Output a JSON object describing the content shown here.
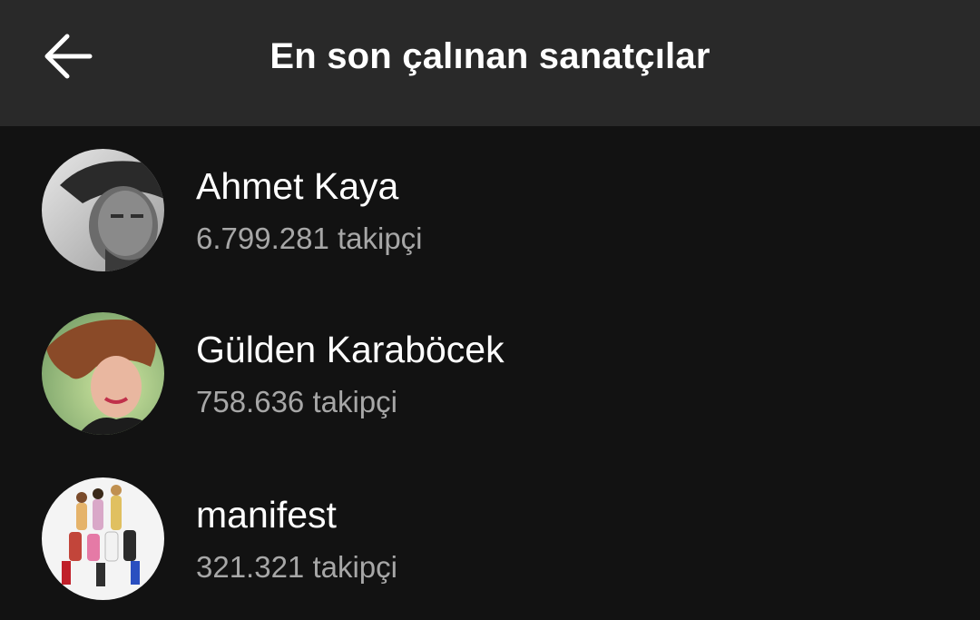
{
  "header": {
    "title": "En son çalınan sanatçılar",
    "back_icon": "arrow-left-icon"
  },
  "artists": [
    {
      "name": "Ahmet Kaya",
      "followers": "6.799.281 takipçi"
    },
    {
      "name": "Gülden Karaböcek",
      "followers": "758.636 takipçi"
    },
    {
      "name": "manifest",
      "followers": "321.321 takipçi"
    }
  ],
  "colors": {
    "background": "#121212",
    "header_background": "#292929",
    "primary_text": "#ffffff",
    "secondary_text": "#a7a7a7"
  }
}
